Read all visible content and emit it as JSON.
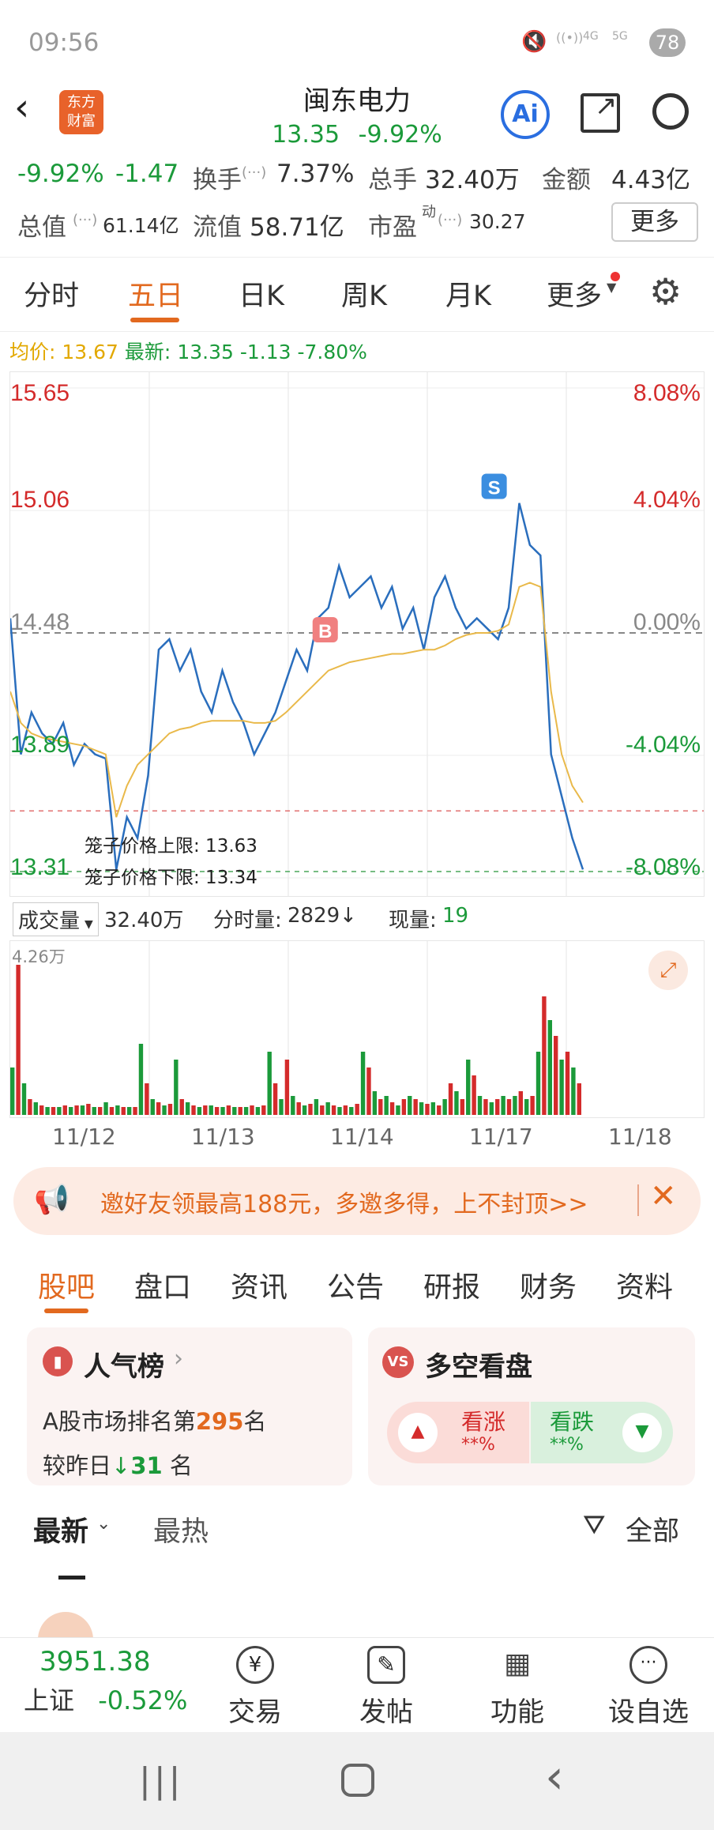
{
  "status_bar": {
    "time": "09:56",
    "battery": "78",
    "net1": "4G",
    "net2": "5G"
  },
  "header": {
    "app_logo_line1": "东方",
    "app_logo_line2": "财富",
    "stock_name": "闽东电力",
    "price": "13.35",
    "change_pct": "-9.92%",
    "ai_label": "Ai"
  },
  "quote": {
    "change_pct": "-9.92%",
    "change_amt": "-1.47",
    "turnover_label": "换手",
    "turnover": "7.37%",
    "volume_label": "总手",
    "volume": "32.40万",
    "amount_label": "金额",
    "amount": "4.43亿",
    "total_mv_label": "总值",
    "total_mv": "61.14亿",
    "float_mv_label": "流值",
    "float_mv": "58.71亿",
    "pe_label": "市盈",
    "pe_sup": "动",
    "pe": "30.27",
    "more_button": "更多"
  },
  "period_tabs": [
    "分时",
    "五日",
    "日K",
    "周K",
    "月K",
    "更多"
  ],
  "info_line": {
    "avg_label": "均价:",
    "avg": "13.67",
    "last_label": "最新:",
    "last": "13.35",
    "chg": "-1.13",
    "pct": "-7.80%"
  },
  "chart_data": {
    "type": "line",
    "left_axis": [
      "15.65",
      "15.06",
      "14.48",
      "13.89",
      "13.31"
    ],
    "right_axis": [
      "8.08%",
      "4.04%",
      "0.00%",
      "-4.04%",
      "-8.08%"
    ],
    "ylim": [
      13.31,
      15.65
    ],
    "prev_close": 14.48,
    "x_labels": [
      "11/12",
      "11/13",
      "11/14",
      "11/17",
      "11/18"
    ],
    "upper_limit_label": "笼子价格上限: 13.63",
    "lower_limit_label": "笼子价格下限: 13.34",
    "upper_limit": 13.63,
    "lower_limit": 13.34,
    "buy_marker": "B",
    "sell_marker": "S",
    "series": [
      {
        "name": "price",
        "values": [
          14.55,
          13.9,
          14.1,
          14.0,
          13.95,
          14.05,
          13.85,
          13.95,
          13.9,
          13.88,
          13.35,
          13.6,
          13.5,
          13.8,
          14.4,
          14.45,
          14.3,
          14.4,
          14.2,
          14.1,
          14.3,
          14.15,
          14.05,
          13.9,
          14.0,
          14.1,
          14.25,
          14.4,
          14.3,
          14.55,
          14.6,
          14.8,
          14.65,
          14.7,
          14.75,
          14.6,
          14.7,
          14.5,
          14.6,
          14.4,
          14.65,
          14.75,
          14.6,
          14.5,
          14.55,
          14.5,
          14.45,
          14.6,
          15.1,
          14.9,
          14.85,
          13.9,
          13.7,
          13.5,
          13.35
        ]
      },
      {
        "name": "avg",
        "values": [
          14.2,
          14.05,
          14.0,
          13.98,
          13.97,
          13.96,
          13.95,
          13.94,
          13.92,
          13.9,
          13.6,
          13.75,
          13.85,
          13.9,
          13.95,
          14.0,
          14.02,
          14.03,
          14.05,
          14.06,
          14.06,
          14.06,
          14.06,
          14.05,
          14.05,
          14.06,
          14.1,
          14.15,
          14.2,
          14.25,
          14.3,
          14.32,
          14.34,
          14.35,
          14.36,
          14.37,
          14.38,
          14.38,
          14.39,
          14.4,
          14.4,
          14.42,
          14.45,
          14.47,
          14.48,
          14.48,
          14.49,
          14.52,
          14.7,
          14.72,
          14.7,
          14.2,
          13.9,
          13.75,
          13.67
        ]
      }
    ]
  },
  "volume_bar": {
    "selector": "成交量",
    "total": "32.40万",
    "tick_label": "分时量:",
    "tick_value": "2829",
    "now_label": "现量:",
    "now_value": "19",
    "max_label": "4.26万"
  },
  "volume_data": [
    0.3,
    0.95,
    0.2,
    0.1,
    0.08,
    0.06,
    0.05,
    0.05,
    0.05,
    0.06,
    0.05,
    0.06,
    0.06,
    0.07,
    0.05,
    0.05,
    0.08,
    0.05,
    0.06,
    0.05,
    0.05,
    0.05,
    0.45,
    0.2,
    0.1,
    0.08,
    0.06,
    0.07,
    0.35,
    0.1,
    0.08,
    0.06,
    0.05,
    0.06,
    0.06,
    0.05,
    0.05,
    0.06,
    0.05,
    0.05,
    0.05,
    0.06,
    0.05,
    0.06,
    0.4,
    0.2,
    0.1,
    0.35,
    0.12,
    0.08,
    0.06,
    0.07,
    0.1,
    0.06,
    0.08,
    0.06,
    0.05,
    0.06,
    0.05,
    0.07,
    0.4,
    0.3,
    0.15,
    0.1,
    0.12,
    0.08,
    0.06,
    0.1,
    0.12,
    0.1,
    0.08,
    0.07,
    0.08,
    0.06,
    0.1,
    0.2,
    0.15,
    0.1,
    0.35,
    0.25,
    0.12,
    0.1,
    0.08,
    0.1,
    0.12,
    0.1,
    0.12,
    0.15,
    0.1,
    0.12,
    0.4,
    0.75,
    0.6,
    0.5,
    0.35,
    0.4,
    0.3,
    0.2
  ],
  "promo": {
    "text": "邀好友领最高188元，多邀多得，上不封顶>>"
  },
  "section_tabs": [
    "股吧",
    "盘口",
    "资讯",
    "公告",
    "研报",
    "财务",
    "资料"
  ],
  "popularity": {
    "title": "人气榜",
    "rank_prefix": "A股市场排名第",
    "rank": "295",
    "rank_suffix": "名",
    "change_prefix": "较昨日",
    "change": "31",
    "change_suffix": "名"
  },
  "sentiment": {
    "title": "多空看盘",
    "up_label": "看涨",
    "up_value": "**%",
    "down_label": "看跌",
    "down_value": "**%"
  },
  "feed_tabs": {
    "latest": "最新",
    "hot": "最热",
    "filter": "全部"
  },
  "bottom_bar": {
    "index_value": "3951.38",
    "index_name": "上证",
    "index_pct": "-0.52%",
    "items": [
      "交易",
      "发帖",
      "功能",
      "设自选"
    ]
  },
  "colors": {
    "accent": "#e2691f",
    "up": "#d42b2b",
    "down": "#1b9a3a",
    "price_line": "#2a6ebd",
    "avg_line": "#e9b94a"
  }
}
